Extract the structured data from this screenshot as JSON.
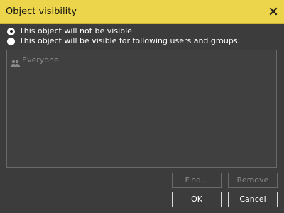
{
  "dialog": {
    "title": "Object visibility",
    "close_icon": "close-icon",
    "colors": {
      "titlebar": "#ecd54a",
      "background": "#3c3c3c"
    }
  },
  "visibility": {
    "option_not_visible": "This object will not be visible",
    "option_visible_for": "This object will be visible for following users and groups:",
    "selected": "not_visible"
  },
  "list": {
    "items": [
      {
        "label": "Everyone",
        "icon": "group-icon",
        "disabled": true
      }
    ]
  },
  "buttons": {
    "find": "Find...",
    "remove": "Remove",
    "ok": "OK",
    "cancel": "Cancel"
  }
}
